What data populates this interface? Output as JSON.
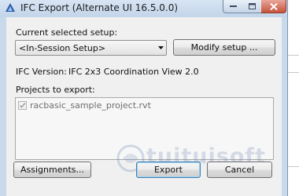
{
  "window": {
    "title": "IFC Export (Alternate UI 16.5.0.0)"
  },
  "setup": {
    "current_label": "Current selected setup:",
    "selected_value": "<In-Session Setup>",
    "modify_button": "Modify setup ..."
  },
  "ifc": {
    "version_label": "IFC Version:",
    "version_value": "IFC 2x3 Coordination View 2.0"
  },
  "projects": {
    "label": "Projects to export:",
    "items": [
      {
        "name": "racbasic_sample_project.rvt",
        "checked": true
      }
    ]
  },
  "buttons": {
    "assignments": "Assignments...",
    "export": "Export",
    "cancel": "Cancel"
  },
  "watermark": {
    "text": "tuituisoft"
  },
  "colors": {
    "title_bar": "#c9d9ec",
    "close_button": "#c6533b",
    "dialog_bg": "#f0f0f0",
    "default_button_border": "#3c7fb1"
  },
  "icons": [
    "app-icon",
    "minimize-icon",
    "maximize-icon",
    "close-icon",
    "dropdown-arrow-icon",
    "checkbox-icon"
  ]
}
